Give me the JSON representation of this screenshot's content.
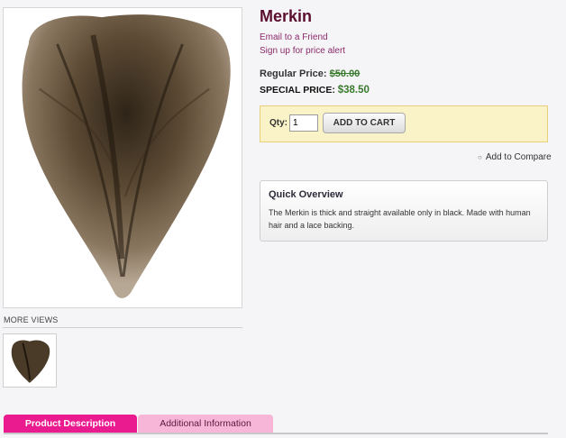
{
  "product": {
    "name": "Merkin",
    "email_link": "Email to a Friend",
    "price_alert_link": "Sign up for price alert",
    "regular_price_label": "Regular Price:",
    "regular_price": "$50.00",
    "special_price_label": "SPECIAL PRICE:",
    "special_price": "$38.50"
  },
  "cart": {
    "qty_label": "Qty:",
    "qty_value": "1",
    "add_button": "ADD TO CART"
  },
  "compare": {
    "label": "Add to Compare"
  },
  "overview": {
    "title": "Quick Overview",
    "text": "The Merkin is thick and straight available only in black. Made with human hair and a lace backing."
  },
  "gallery": {
    "more_views_label": "MORE VIEWS"
  },
  "tabs": [
    {
      "label": "Product Description",
      "active": true
    },
    {
      "label": "Additional Information",
      "active": false
    }
  ],
  "colors": {
    "title": "#5a0f2e",
    "link": "#8b2a6b",
    "price_green": "#3a7a2e",
    "tab_active": "#ea1a8f",
    "tab_inactive": "#f7b6d8",
    "cart_box": "#fbf3c8"
  }
}
